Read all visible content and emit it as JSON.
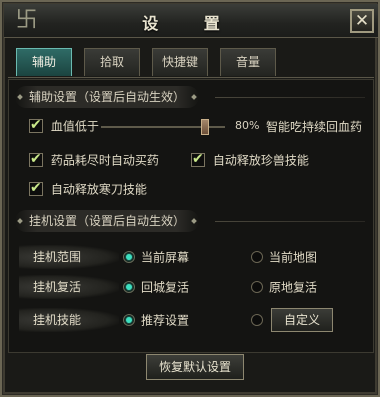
{
  "window": {
    "title": "设 置"
  },
  "tabs": [
    {
      "label": "辅助",
      "active": true
    },
    {
      "label": "拾取",
      "active": false
    },
    {
      "label": "快捷键",
      "active": false
    },
    {
      "label": "音量",
      "active": false
    }
  ],
  "assist": {
    "header": "辅助设置（设置后自动生效）",
    "hp_low": {
      "label": "血值低于",
      "checked": true,
      "value_text": "80%",
      "value": 0.8,
      "note": "智能吃持续回血药"
    },
    "auto_buy": {
      "label": "药品耗尽时自动买药",
      "checked": true
    },
    "auto_rare_pet": {
      "label": "自动释放珍兽技能",
      "checked": true
    },
    "auto_cold_blade": {
      "label": "自动释放寒刀技能",
      "checked": true
    }
  },
  "idle": {
    "header": "挂机设置（设置后自动生效）",
    "rows": [
      {
        "label": "挂机范围",
        "options": [
          "当前屏幕",
          "当前地图"
        ],
        "selected": 0
      },
      {
        "label": "挂机复活",
        "options": [
          "回城复活",
          "原地复活"
        ],
        "selected": 0
      },
      {
        "label": "挂机技能",
        "options": [
          "推荐设置"
        ],
        "selected": 0,
        "custom_label": "自定义"
      }
    ]
  },
  "footer": {
    "reset_label": "恢复默认设置"
  },
  "colors": {
    "accent": "#3ee0c0",
    "check": "#c9e88a",
    "tab_active": "#2f6b66"
  }
}
